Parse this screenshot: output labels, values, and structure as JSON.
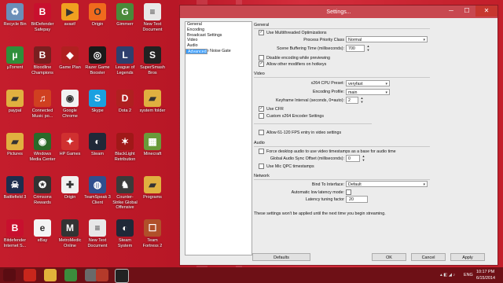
{
  "desktop": {
    "icons": [
      {
        "label": "Recycle Bin",
        "color": "#6b8fb8",
        "glyph": "♻"
      },
      {
        "label": "BitDefender Safepay",
        "color": "#c8102e",
        "glyph": "B"
      },
      {
        "label": "avast!",
        "color": "#f0a020",
        "glyph": "▶"
      },
      {
        "label": "Origin",
        "color": "#f06a1d",
        "glyph": "O"
      },
      {
        "label": "Gimmerr",
        "color": "#4a8a3a",
        "glyph": "G"
      },
      {
        "label": "New Text Document",
        "color": "#e8e8e8",
        "glyph": "≡"
      },
      {
        "label": "µTorrent",
        "color": "#2f8f3a",
        "glyph": "µ"
      },
      {
        "label": "Bloodline Champions",
        "color": "#7a1f20",
        "glyph": "B"
      },
      {
        "label": "Game Plan",
        "color": "#b02020",
        "glyph": "◆"
      },
      {
        "label": "Razer Game Booster",
        "color": "#1a1a1a",
        "glyph": "◎"
      },
      {
        "label": "League of Legends",
        "color": "#2e3f6e",
        "glyph": "L"
      },
      {
        "label": "SuperSmash Bros",
        "color": "#222",
        "glyph": "S"
      },
      {
        "label": "paypal",
        "color": "#e0b040",
        "glyph": "▰"
      },
      {
        "label": "Connected Music po...",
        "color": "#d04020",
        "glyph": "♫"
      },
      {
        "label": "Google Chrome",
        "color": "#f2f2f2",
        "glyph": "◉"
      },
      {
        "label": "Skype",
        "color": "#1aa0e0",
        "glyph": "S"
      },
      {
        "label": "Dota 2",
        "color": "#b02020",
        "glyph": "D"
      },
      {
        "label": "system folder",
        "color": "#e0b040",
        "glyph": "▰"
      },
      {
        "label": "Pictures",
        "color": "#e0b040",
        "glyph": "▰"
      },
      {
        "label": "Windows Media Center",
        "color": "#2a6a2a",
        "glyph": "◉"
      },
      {
        "label": "HP Games",
        "color": "#d03030",
        "glyph": "✦"
      },
      {
        "label": "Steam",
        "color": "#202838",
        "glyph": "◐"
      },
      {
        "label": "BlackLight Retribution",
        "color": "#a01818",
        "glyph": "✶"
      },
      {
        "label": "Minecraft",
        "color": "#6a9a3a",
        "glyph": "▦"
      },
      {
        "label": "Battlefield 3",
        "color": "#1d2d4d",
        "glyph": "☠"
      },
      {
        "label": "Crimsons Rewards",
        "color": "#333",
        "glyph": "✪"
      },
      {
        "label": "Origin",
        "color": "#f0f0f0",
        "glyph": "✚"
      },
      {
        "label": "TeamSpeak 3 Client",
        "color": "#2f4f8f",
        "glyph": "◍"
      },
      {
        "label": "Counter-Strike Global Offensive",
        "color": "#3a3a3a",
        "glyph": "♞"
      },
      {
        "label": "Programs",
        "color": "#e0b040",
        "glyph": "▰"
      },
      {
        "label": "Bitdefender Internet S...",
        "color": "#c8102e",
        "glyph": "B"
      },
      {
        "label": "eBay",
        "color": "#f4f4f4",
        "glyph": "e"
      },
      {
        "label": "MetroMedic Online",
        "color": "#333",
        "glyph": "M"
      },
      {
        "label": "New Text Document",
        "color": "#e8e8e8",
        "glyph": "≡"
      },
      {
        "label": "Steam System",
        "color": "#202838",
        "glyph": "◐"
      },
      {
        "label": "Team Fortress 2",
        "color": "#b0502a",
        "glyph": "☐"
      }
    ]
  },
  "window": {
    "title": "Settings...",
    "minimize_glyph": "─",
    "maximize_glyph": "☐",
    "close_glyph": "✕"
  },
  "nav": {
    "items": [
      "General",
      "Encoding",
      "Broadcast Settings",
      "Video",
      "Audio",
      "Advanced",
      "Microphone Noise Gate"
    ],
    "selected_index": 5
  },
  "general": {
    "heading": "General",
    "use_multithreaded": {
      "label": "Use Multithreaded Optimizations",
      "checked": true
    },
    "process_priority": {
      "label": "Process Priority Class",
      "value": "Normal"
    },
    "scene_buffering": {
      "label": "Scene Buffering Time (milliseconds):",
      "value": "700"
    },
    "disable_encoding_preview": {
      "label": "Disable encoding while previewing",
      "checked": false
    },
    "allow_other_modifiers": {
      "label": "Allow other modifiers on hotkeys",
      "checked": true
    }
  },
  "video": {
    "heading": "Video",
    "x264_preset": {
      "label": "x264 CPU Preset:",
      "value": "veryfast"
    },
    "encoding_profile": {
      "label": "Encoding Profile:",
      "value": "main"
    },
    "keyframe_interval": {
      "label": "Keyframe Interval (seconds, 0=auto):",
      "value": "2"
    },
    "use_cfr": {
      "label": "Use CFR",
      "checked": true
    },
    "custom_x264": {
      "label": "Custom x264 Encoder Settings",
      "checked": false
    },
    "allow_61_120": {
      "label": "Allow 61-120 FPS entry in video settings",
      "checked": false
    }
  },
  "audio": {
    "heading": "Audio",
    "force_desktop_audio": {
      "label": "Force desktop audio to use video timestamps as a base for audio time",
      "checked": false
    },
    "global_sync_offset": {
      "label": "Global Audio Sync Offset (milliseconds):",
      "value": "0"
    },
    "use_mic_qpc": {
      "label": "Use Mic QPC timestamps",
      "checked": false
    }
  },
  "network": {
    "heading": "Network",
    "bind_to_interface": {
      "label": "Bind To Interface:",
      "value": "Default"
    },
    "auto_low_latency": {
      "label": "Automatic low latency mode:",
      "checked": false
    },
    "latency_tuning": {
      "label": "Latency tuning factor",
      "value": "20"
    }
  },
  "notice": "These settings won't be applied until the next time you begin streaming.",
  "buttons": {
    "defaults": "Defaults",
    "ok": "OK",
    "cancel": "Cancel",
    "apply": "Apply"
  },
  "taskbar": {
    "language": "ENG",
    "time": "10:17 PM",
    "date": "6/15/2014"
  }
}
